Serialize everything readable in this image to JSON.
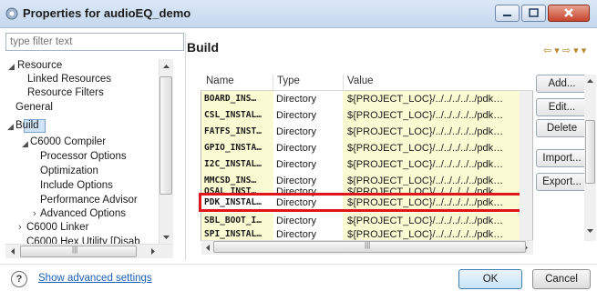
{
  "window": {
    "title": "Properties for audioEQ_demo",
    "controls": {
      "minimize": "—",
      "maximize": "▢",
      "close": "✕"
    }
  },
  "filter": {
    "placeholder": "type filter text"
  },
  "tree": {
    "items": [
      {
        "label": "Resource",
        "twisty": "◢"
      },
      {
        "label": "Linked Resources"
      },
      {
        "label": "Resource Filters"
      },
      {
        "label": "General"
      },
      {
        "label": "Build",
        "twisty": "◢",
        "selected": true
      },
      {
        "label": "C6000 Compiler",
        "twisty": "◢"
      },
      {
        "label": "Processor Options"
      },
      {
        "label": "Optimization"
      },
      {
        "label": "Include Options"
      },
      {
        "label": "Performance Advisor"
      },
      {
        "label": "Advanced Options",
        "twisty": "›"
      },
      {
        "label": "C6000 Linker",
        "twisty": "›"
      },
      {
        "label": "C6000 Hex Utility  [Disab"
      }
    ],
    "hscroll_glyph": "|||"
  },
  "panel": {
    "header": "Build",
    "nav_arrows": "⇦ ▾ ⇨ ▾ ▾"
  },
  "table": {
    "columns": [
      "Name",
      "Type",
      "Value"
    ],
    "rows": [
      {
        "name": "BOARD_INS…",
        "type": "Directory",
        "value": "${PROJECT_LOC}/../../../../../pdk…"
      },
      {
        "name": "CSL_INSTAL…",
        "type": "Directory",
        "value": "${PROJECT_LOC}/../../../../../pdk…"
      },
      {
        "name": "FATFS_INST…",
        "type": "Directory",
        "value": "${PROJECT_LOC}/../../../../../pdk…"
      },
      {
        "name": "GPIO_INSTA…",
        "type": "Directory",
        "value": "${PROJECT_LOC}/../../../../../pdk…"
      },
      {
        "name": "I2C_INSTAL…",
        "type": "Directory",
        "value": "${PROJECT_LOC}/../../../../../pdk…"
      },
      {
        "name": "MMCSD_INS…",
        "type": "Directory",
        "value": "${PROJECT_LOC}/../../../../../pdk…"
      },
      {
        "name": "OSAL_INST…",
        "type": "Directory",
        "value": "${PROJECT_LOC}/../../../../../pdk…"
      },
      {
        "name": "PDK_INSTAL…",
        "type": "Directory",
        "value": "${PROJECT_LOC}/../../../../../pdk…",
        "highlighted": true
      },
      {
        "name": "SBL_BOOT_I…",
        "type": "Directory",
        "value": "${PROJECT_LOC}/../../../../../pdk…"
      },
      {
        "name": "SPI_INSTAL…",
        "type": "Directory",
        "value": "${PROJECT_LOC}/../../../../../pdk…"
      }
    ],
    "hscroll_glyph": "|||"
  },
  "side_buttons": [
    "Add...",
    "Edit...",
    "Delete",
    "Import...",
    "Export..."
  ],
  "footer": {
    "help_icon": "?",
    "advanced_link": "Show advanced settings",
    "ok": "OK",
    "cancel": "Cancel"
  },
  "colors": {
    "highlight_border": "#e0141b",
    "cell_fill": "#fbfbd3",
    "link": "#1b5fb5"
  }
}
